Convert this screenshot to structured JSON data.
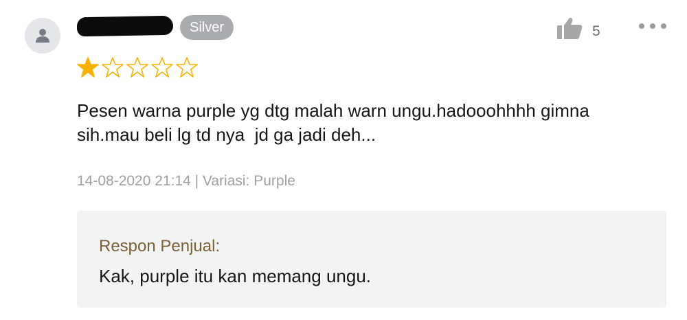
{
  "review": {
    "badge": "Silver",
    "like_icon": "thumbs-up-icon",
    "like_count": "5",
    "more_icon": "more-dots-icon",
    "rating": 1,
    "rating_max": 5,
    "star_color_filled": "#f5b301",
    "star_color_empty": "#f5b301",
    "comment": "Pesen warna purple yg dtg malah warn ungu.hadooohhhh gimna\nsih.mau beli lg td nya  jd ga jadi deh...",
    "meta": "14-08-2020 21:14 | Variasi: Purple",
    "seller_response": {
      "label": "Respon Penjual:",
      "text": "Kak, purple itu kan memang ungu."
    }
  }
}
